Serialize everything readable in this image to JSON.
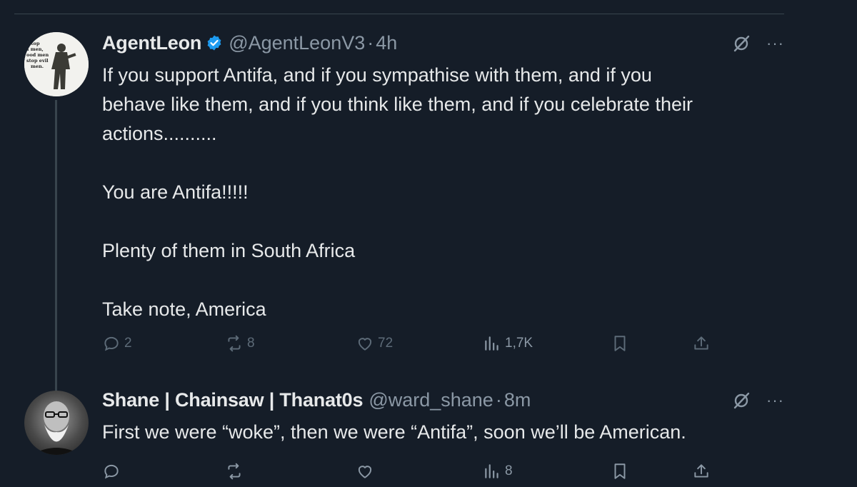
{
  "tweets": [
    {
      "author_name": "AgentLeon",
      "handle": "@AgentLeonV3",
      "separator": "·",
      "time": "4h",
      "verified": true,
      "avatar_text": [
        "stop",
        "l men,",
        "ood men",
        "stop evil",
        "men."
      ],
      "body": [
        "If you support Antifa, and if you sympathise with them, and if you",
        "behave like them, and if you think like them, and if you celebrate their",
        "actions..........",
        "",
        "You are Antifa!!!!!",
        "",
        "Plenty of them in South Africa",
        "",
        "Take note, America"
      ],
      "stats": {
        "replies": "2",
        "reposts": "8",
        "likes": "72",
        "views": "1,7K"
      }
    },
    {
      "author_name": "Shane | Chainsaw | Thanat0s",
      "handle": "@ward_shane",
      "separator": "·",
      "time": "8m",
      "verified": false,
      "body": [
        "First we were “woke”, then we were “Antifa”, soon we’ll be American."
      ],
      "stats": {
        "replies": "",
        "reposts": "",
        "likes": "",
        "views": "8"
      }
    }
  ],
  "icons": {
    "more": "···",
    "grok": "grok-icon",
    "reply": "reply-icon",
    "repost": "repost-icon",
    "like": "like-icon",
    "views": "views-icon",
    "bookmark": "bookmark-icon",
    "share": "share-icon"
  },
  "colors": {
    "background": "#151d28",
    "text": "#e7e9ea",
    "muted": "#8b98a5",
    "verified": "#1d9bf0",
    "divider": "#38444d"
  }
}
